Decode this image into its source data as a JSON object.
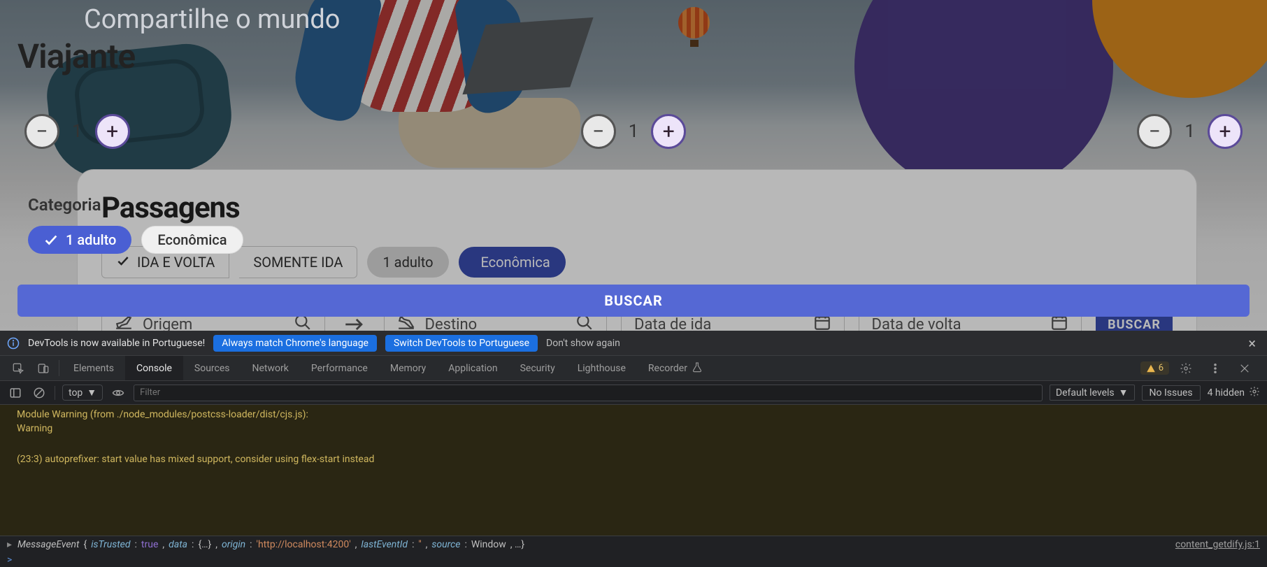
{
  "hero": {
    "share_line": "Compartilhe o mundo"
  },
  "popup": {
    "title": "Viajante",
    "counters": [
      {
        "value": "1"
      },
      {
        "value": "1"
      },
      {
        "value": "1"
      }
    ],
    "category_label": "Categoria",
    "chips": {
      "adult": "1 adulto",
      "economy": "Econômica"
    },
    "search_button": "BUSCAR"
  },
  "card": {
    "title": "Passagens",
    "trip_roundtrip": "IDA E VOLTA",
    "trip_oneway": "SOMENTE IDA",
    "pax_pill": "1 adulto",
    "class_pill": "Econômica",
    "fields": {
      "origin": "Origem",
      "destination": "Destino",
      "depart": "Data de ida",
      "return": "Data de volta"
    },
    "search_button": "BUSCAR"
  },
  "devtools": {
    "banner": {
      "message": "DevTools is now available in Portuguese!",
      "always_match": "Always match Chrome's language",
      "switch_to": "Switch DevTools to Portuguese",
      "dont_show": "Don't show again"
    },
    "tabs": {
      "elements": "Elements",
      "console": "Console",
      "sources": "Sources",
      "network": "Network",
      "performance": "Performance",
      "memory": "Memory",
      "application": "Application",
      "security": "Security",
      "lighthouse": "Lighthouse",
      "recorder": "Recorder"
    },
    "warn_count": "6",
    "toolbar": {
      "context": "top",
      "filter_placeholder": "Filter",
      "levels": "Default levels",
      "issues": "No Issues",
      "hidden": "4 hidden"
    },
    "console_lines": {
      "l1": "Module Warning (from ./node_modules/postcss-loader/dist/cjs.js):",
      "l2": "Warning",
      "l3": "(23:3) autoprefixer: start value has mixed support, consider using flex-start instead"
    },
    "message_event": {
      "name": "MessageEvent",
      "isTrusted_key": "isTrusted",
      "isTrusted_val": "true",
      "data_key": "data",
      "data_val": "{…}",
      "origin_key": "origin",
      "origin_val": "'http://localhost:4200'",
      "lastEventId_key": "lastEventId",
      "lastEventId_val": "''",
      "source_key": "source",
      "source_val": "Window",
      "tail": ", …}",
      "link": "content_getdify.js:1"
    },
    "prompt": ">"
  }
}
